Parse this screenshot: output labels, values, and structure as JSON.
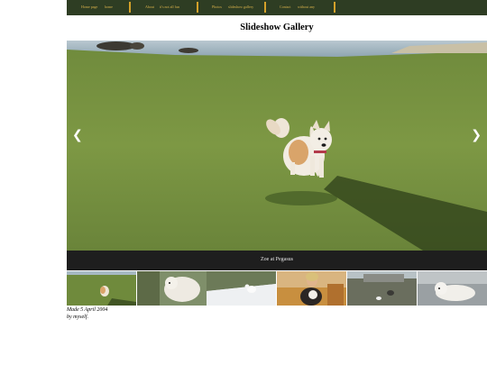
{
  "nav": {
    "items": [
      {
        "label": "Home page",
        "sub": "home"
      },
      {
        "label": "About",
        "sub": "it's not all fun"
      },
      {
        "label": "Photos",
        "sub": "slideshow gallery"
      },
      {
        "label": "Contact",
        "sub": "without any"
      }
    ],
    "accent": "#d4a12a",
    "bar_color": "#2e3d23"
  },
  "page": {
    "title": "Slideshow Gallery"
  },
  "slideshow": {
    "caption": "Zoe at Pegasus",
    "prev_glyph": "❮",
    "next_glyph": "❯"
  },
  "thumbnails": [
    {
      "name": "thumb-dog-on-grass"
    },
    {
      "name": "thumb-white-dog-resting"
    },
    {
      "name": "thumb-dog-in-snow"
    },
    {
      "name": "thumb-person-with-dog"
    },
    {
      "name": "thumb-dog-in-yard"
    },
    {
      "name": "thumb-white-dog-lying"
    }
  ],
  "footer": {
    "line1": "Made 5 April 2004",
    "line2": "by myself."
  }
}
